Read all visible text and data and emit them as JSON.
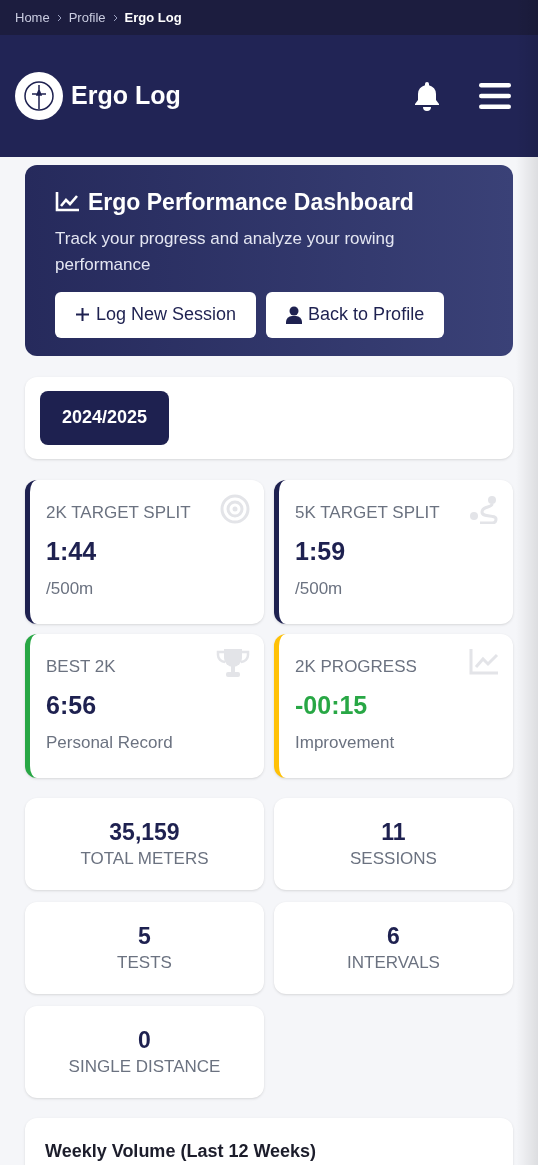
{
  "breadcrumb": [
    {
      "label": "Home",
      "current": false
    },
    {
      "label": "Profile",
      "current": false
    },
    {
      "label": "Ergo Log",
      "current": true
    }
  ],
  "header": {
    "title": "Ergo Log"
  },
  "hero": {
    "title": "Ergo Performance Dashboard",
    "subtitle": "Track your progress and analyze your rowing performance",
    "buttons": [
      "Log New Session",
      "Back to Profile"
    ]
  },
  "seasons": [
    {
      "label": "2024/2025",
      "selected": true
    }
  ],
  "metric_cards": [
    {
      "label": "2K TARGET SPLIT",
      "value": "1:44",
      "note": "/500m",
      "color": "#1e2150",
      "positive": false
    },
    {
      "label": "5K TARGET SPLIT",
      "value": "1:59",
      "note": "/500m",
      "color": "#1e2150",
      "positive": false
    },
    {
      "label": "BEST 2K",
      "value": "6:56",
      "note": "Personal Record",
      "color": "#28a745",
      "positive": false
    },
    {
      "label": "2K PROGRESS",
      "value": "-00:15",
      "note": "Improvement",
      "color": "#ffc107",
      "positive": true
    }
  ],
  "counts": [
    {
      "value": "35,159",
      "label": "TOTAL METERS"
    },
    {
      "value": "11",
      "label": "SESSIONS"
    },
    {
      "value": "5",
      "label": "TESTS"
    },
    {
      "value": "6",
      "label": "INTERVALS"
    },
    {
      "value": "0",
      "label": "SINGLE DISTANCE"
    }
  ],
  "weekly_volume": {
    "title": "Weekly Volume (Last 12 Weeks)"
  }
}
